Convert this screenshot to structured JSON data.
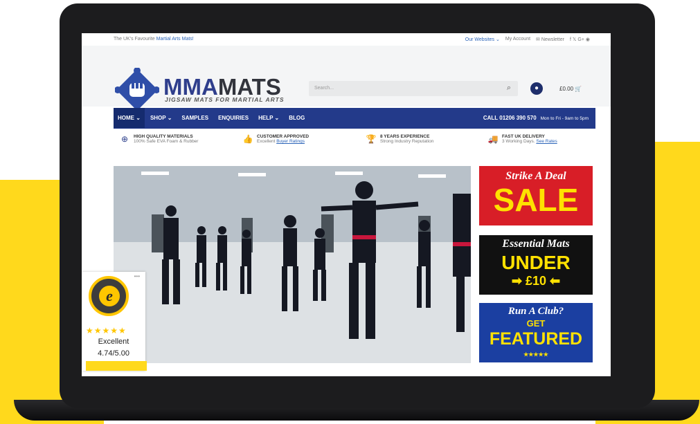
{
  "topbar": {
    "tagline_prefix": "The UK's Favourite",
    "tagline_link": "Martial Arts Mats!",
    "our_websites": "Our Websites ⌄",
    "my_account": "My Account",
    "newsletter": "✉ Newsletter",
    "social": "f  𝕏  G+  ◉"
  },
  "header": {
    "brand_a": "MMA",
    "brand_b": "MATS",
    "tagline": "JIGSAW MATS FOR MARTIAL ARTS",
    "search_placeholder": "Search...",
    "cart_total": "£0.00"
  },
  "nav": {
    "items": [
      "HOME ⌄",
      "SHOP ⌄",
      "SAMPLES",
      "ENQUIRIES",
      "HELP ⌄",
      "BLOG"
    ],
    "call_label": "CALL  01206 390 570",
    "hours": "Mon to Fri - 9am to 5pm"
  },
  "usps": [
    {
      "icon": "search-plus-icon",
      "title": "HIGH QUALITY MATERIALS",
      "sub": "100% Safe EVA Foam & Rubber",
      "link": ""
    },
    {
      "icon": "thumbs-up-icon",
      "title": "CUSTOMER APPROVED",
      "sub": "Excellent",
      "link": "Buyer Ratings"
    },
    {
      "icon": "trophy-icon",
      "title": "8 YEARS EXPERIENCE",
      "sub": "Strong Industry Reputation",
      "link": ""
    },
    {
      "icon": "truck-icon",
      "title": "FAST UK DELIVERY",
      "sub": "3 Working Days.",
      "link": "See Rates"
    }
  ],
  "banners": {
    "sale_top": "Strike A Deal",
    "sale_main": "SALE",
    "essential_top": "Essential Mats",
    "essential_main": "UNDER",
    "essential_price": "➡ £10 ⬅",
    "club_top": "Run A Club?",
    "club_get": "GET",
    "club_main": "FEATURED",
    "club_stars": "★★★★★"
  },
  "trust": {
    "stars": "★★★★★",
    "rating_text": "Excellent",
    "score": "4.74/5.00",
    "seal_letter": "e",
    "menu": "•••"
  },
  "colors": {
    "yellow": "#ffd91c",
    "navy": "#233a8a",
    "red_banner": "#d81e27",
    "blue_banner": "#1b3fa1"
  }
}
